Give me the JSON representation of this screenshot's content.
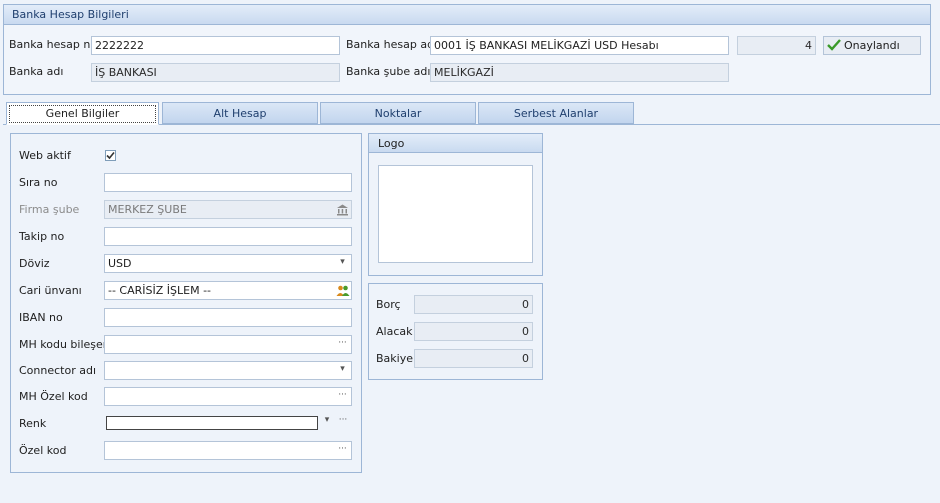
{
  "header": {
    "title": "Banka Hesap Bilgileri",
    "hesap_no_label": "Banka hesap no",
    "hesap_no_value": "2222222",
    "hesap_adi_label": "Banka hesap adı",
    "hesap_adi_value": "0001 İŞ BANKASI MELİKGAZİ USD Hesabı",
    "count_value": "4",
    "status_label": "Onaylandı",
    "banka_adi_label": "Banka adı",
    "banka_adi_value": "İŞ BANKASI",
    "sube_adi_label": "Banka şube adı",
    "sube_adi_value": "MELİKGAZİ"
  },
  "tabs": [
    {
      "label": "Genel Bilgiler"
    },
    {
      "label": "Alt Hesap"
    },
    {
      "label": "Noktalar"
    },
    {
      "label": "Serbest Alanlar"
    }
  ],
  "form": {
    "web_aktif_label": "Web aktif",
    "web_aktif_checked": true,
    "sira_no_label": "Sıra no",
    "sira_no_value": "",
    "firma_sube_label": "Firma şube",
    "firma_sube_value": "MERKEZ ŞUBE",
    "takip_no_label": "Takip no",
    "takip_no_value": "",
    "doviz_label": "Döviz",
    "doviz_value": "USD",
    "cari_unvani_label": "Cari ünvanı",
    "cari_unvani_value": "-- CARİSİZ İŞLEM --",
    "iban_label": "IBAN no",
    "iban_value": "",
    "mh_kodu_label": "MH kodu bileşeni",
    "mh_kodu_value": "",
    "connector_label": "Connector adı",
    "connector_value": "",
    "mh_ozel_label": "MH Özel kod",
    "mh_ozel_value": "",
    "renk_label": "Renk",
    "renk_value": "",
    "ozel_kod_label": "Özel kod",
    "ozel_kod_value": ""
  },
  "logo": {
    "title": "Logo"
  },
  "totals": {
    "borc_label": "Borç",
    "borc_value": "0",
    "alacak_label": "Alacak",
    "alacak_value": "0",
    "bakiye_label": "Bakiye",
    "bakiye_value": "0"
  },
  "icons": {
    "dropdown": "chevron-down-icon",
    "ellipsis": "ellipsis-icon",
    "check": "check-icon",
    "bank": "bank-icon",
    "people": "people-icon"
  },
  "colors": {
    "border": "#9db6d6",
    "background": "#eef3fa",
    "title_text": "#1f3f6e",
    "approved_check": "#3a9a2a"
  }
}
